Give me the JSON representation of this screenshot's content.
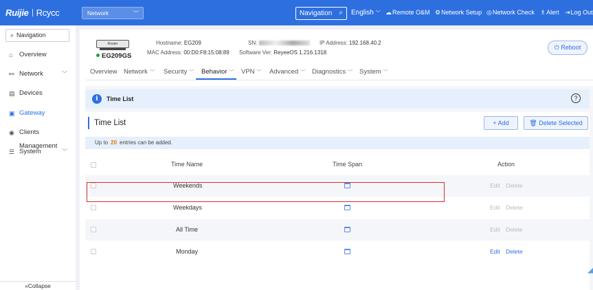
{
  "header": {
    "logo_primary": "Ruijie",
    "logo_secondary": "Rcycc",
    "network_select": "Network",
    "navigation_label": "Navigation",
    "language": "English",
    "links": [
      "Remote O&M",
      "Network Setup",
      "Network Check",
      "Alert",
      "Log Out"
    ]
  },
  "sidebar": {
    "search_label": "Navigation",
    "items": [
      {
        "label": "Overview",
        "icon": "home-icon",
        "chevron": false
      },
      {
        "label": "Network",
        "icon": "network-icon",
        "chevron": true
      },
      {
        "label": "Devices",
        "icon": "devices-icon",
        "chevron": false
      },
      {
        "label": "Gateway",
        "icon": "gateway-icon",
        "chevron": false,
        "active": true
      },
      {
        "label": "Clients Management",
        "icon": "clients-icon",
        "chevron": false
      },
      {
        "label": "System",
        "icon": "settings-icon",
        "chevron": true
      }
    ],
    "collapse_label": "Collapse"
  },
  "device": {
    "badge": "Router",
    "model": "EG209GS",
    "hostname_label": "Hostname:",
    "hostname": "EG209",
    "mac_label": "MAC Address:",
    "mac": "00:D0:F8:15:08:89",
    "sn_label": "SN:",
    "software_label": "Software Ver:",
    "software": "ReyeeOS 1.216.1318",
    "ip_label": "IP Address:",
    "ip": "192.168.40.2",
    "reboot_label": "Reboot"
  },
  "tabs": [
    "Overview",
    "Network",
    "Security",
    "Behavior",
    "VPN",
    "Advanced",
    "Diagnostics",
    "System"
  ],
  "active_tab": "Behavior",
  "section_title": "Time List",
  "panel": {
    "title": "Time List",
    "add_label": "+ Add",
    "delete_selected_label": "Delete Selected",
    "note_prefix": "Up to",
    "note_count": "20",
    "note_suffix": "entries can be added."
  },
  "table": {
    "headers": [
      "Time Name",
      "Time Span",
      "Action"
    ],
    "rows": [
      {
        "name": "Weekends",
        "edit": "Edit",
        "delete": "Delete",
        "enabled": false
      },
      {
        "name": "Weekdays",
        "edit": "Edit",
        "delete": "Delete",
        "enabled": false
      },
      {
        "name": "All Time",
        "edit": "Edit",
        "delete": "Delete",
        "enabled": false
      },
      {
        "name": "Monday",
        "edit": "Edit",
        "delete": "Delete",
        "enabled": true
      }
    ]
  },
  "colors": {
    "brand": "#2e6fe0",
    "highlight": "#d42d2d",
    "accent_number": "#e07b00"
  }
}
